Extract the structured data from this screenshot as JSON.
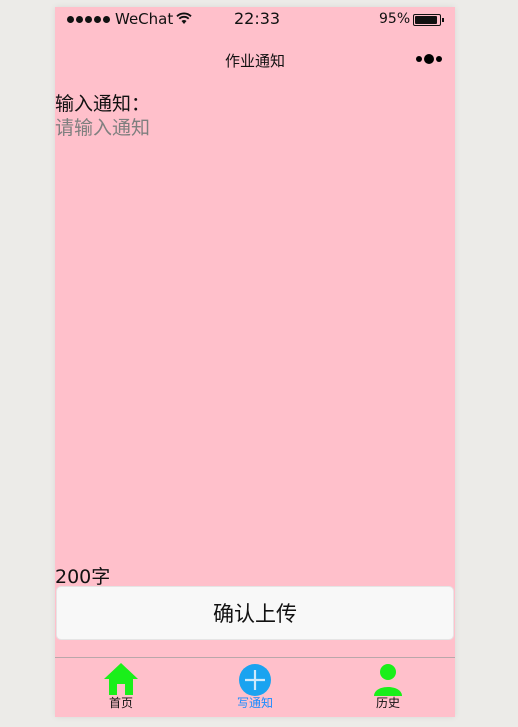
{
  "status_bar": {
    "carrier": "WeChat",
    "time": "22:33",
    "battery": "95%"
  },
  "nav": {
    "title": "作业通知",
    "more_icon": "more-dots-icon"
  },
  "form": {
    "input_label": "输入通知：",
    "input_placeholder": "请输入通知",
    "input_value": "",
    "char_count": "200字",
    "submit_label": "确认上传"
  },
  "tab_bar": {
    "items": [
      {
        "label": "首页",
        "icon": "home-icon",
        "active": false
      },
      {
        "label": "写通知",
        "icon": "add-circle-icon",
        "active": true
      },
      {
        "label": "历史",
        "icon": "user-icon",
        "active": false
      }
    ]
  },
  "colors": {
    "background": "#ffc0cb",
    "tab_icon_green": "#1aef1a",
    "tab_active_blue": "#1aa3f0",
    "tab_active_label": "#1a8cff"
  }
}
